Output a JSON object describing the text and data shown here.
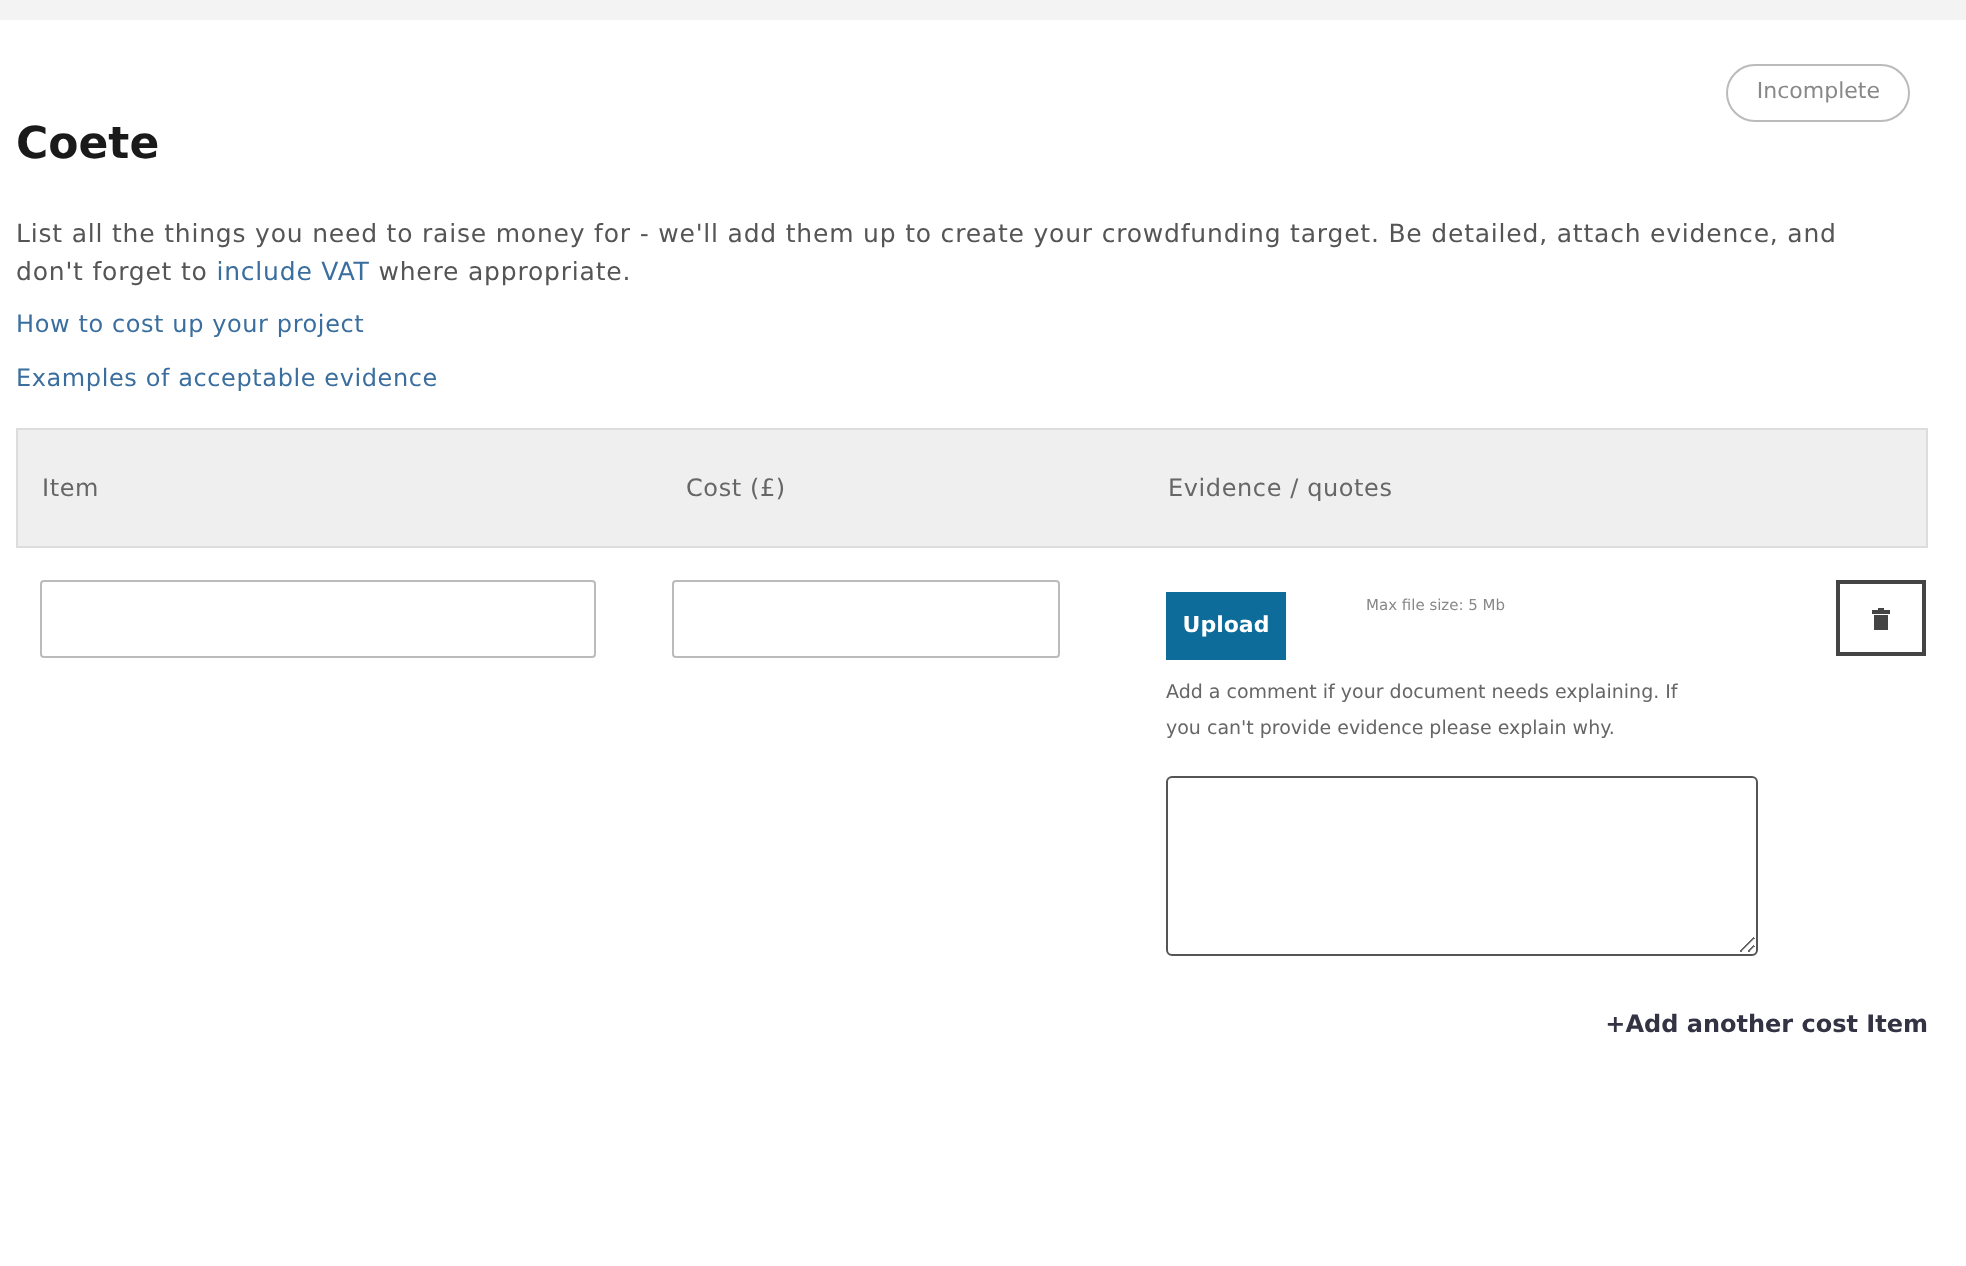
{
  "title": "Coete",
  "status_badge": "Incomplete",
  "intro": {
    "before": "List all the things you need to raise money for - we'll add them up to create your crowdfunding target. Be detailed, attach evidence, and don't forget to ",
    "link": "include VAT",
    "after": " where appropriate."
  },
  "help_links": [
    "How to cost up your project",
    "Examples of acceptable evidence"
  ],
  "table": {
    "columns": [
      "Item",
      "Cost (£)",
      "Evidence / quotes"
    ],
    "rows": [
      {
        "upload_button": "Upload",
        "max_size": "Max file size: 5 Mb",
        "comment_hint": "Add a comment if your document needs explaining. If you can't provide evidence please explain why."
      }
    ]
  },
  "add_link": "+Add another cost Item"
}
